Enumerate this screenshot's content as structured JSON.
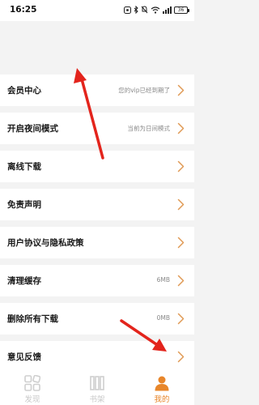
{
  "status_bar": {
    "time": "16:25",
    "battery": "36",
    "icons": [
      "message-icon",
      "bluetooth-icon",
      "mute-icon",
      "wifi-icon",
      "signal-icon",
      "battery-icon"
    ]
  },
  "settings": {
    "items": [
      {
        "label": "会员中心",
        "value": "您的vip已经到期了"
      },
      {
        "label": "开启夜间模式",
        "value": "当前为日间模式"
      },
      {
        "label": "离线下载",
        "value": ""
      },
      {
        "label": "免责声明",
        "value": ""
      },
      {
        "label": "用户协议与隐私政策",
        "value": ""
      },
      {
        "label": "清理缓存",
        "value": "6MB"
      },
      {
        "label": "删除所有下载",
        "value": "0MB"
      },
      {
        "label": "意见反馈",
        "value": ""
      }
    ]
  },
  "bottom_nav": {
    "tabs": [
      {
        "label": "发现",
        "icon": "discover-grid-icon",
        "active": false
      },
      {
        "label": "书架",
        "icon": "bookshelf-icon",
        "active": false
      },
      {
        "label": "我的",
        "icon": "profile-person-icon",
        "active": true
      }
    ]
  },
  "colors": {
    "accent": "#e8862a",
    "chevron": "#e09a55",
    "annotation_arrow": "#e3241c",
    "inactive_tab": "#c9c9c9",
    "background": "#f3f3f3"
  }
}
